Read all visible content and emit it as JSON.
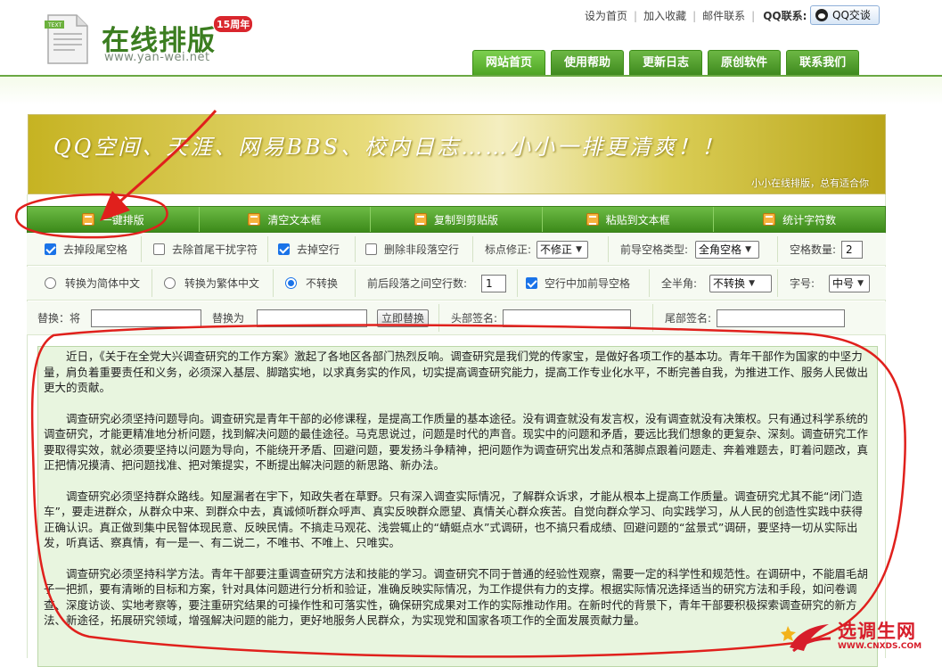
{
  "site": {
    "title": "在线排版",
    "badge": "15周年",
    "url": "www.yan-wei.net"
  },
  "toplinks": [
    "设为首页",
    "加入收藏",
    "邮件联系"
  ],
  "qq_label": "QQ联系:",
  "qq_button": "QQ交谈",
  "nav": [
    {
      "label": "网站首页",
      "active": true
    },
    {
      "label": "使用帮助",
      "active": false
    },
    {
      "label": "更新日志",
      "active": false
    },
    {
      "label": "原创软件",
      "active": false
    },
    {
      "label": "联系我们",
      "active": false
    }
  ],
  "banner": {
    "text": "QQ空间、天涯、网易BBS、校内日志……小小一排更清爽！！",
    "sub": "小小在线排版，总有适合你"
  },
  "toolbar": [
    "一键排版",
    "清空文本框",
    "复制到剪贴版",
    "粘贴到文本框",
    "统计字符数"
  ],
  "row1": {
    "trim_tail": {
      "label": "去掉段尾空格",
      "checked": true
    },
    "trim_head": {
      "label": "去除首尾干扰字符",
      "checked": false
    },
    "remove_blank": {
      "label": "去掉空行",
      "checked": true
    },
    "delete_blank_between": {
      "label": "删除非段落空行",
      "checked": false
    },
    "punct_label": "标点修正:",
    "punct_value": "不修正",
    "lead_type_label": "前导空格类型:",
    "lead_type_value": "全角空格",
    "space_count_label": "空格数量:",
    "space_count_value": "2"
  },
  "row2": {
    "to_simplified": {
      "label": "转换为简体中文",
      "checked": false
    },
    "to_traditional": {
      "label": "转换为繁体中文",
      "checked": false
    },
    "no_convert": {
      "label": "不转换",
      "checked": true
    },
    "blank_lines_label": "前后段落之间空行数:",
    "blank_lines_value": "1",
    "lead_in_blank": {
      "label": "空行中加前导空格",
      "checked": true
    },
    "width_label": "全半角:",
    "width_value": "不转换",
    "font_label": "字号:",
    "font_value": "中号"
  },
  "row3": {
    "replace_label": "替换：将",
    "replace_with_label": "替换为",
    "replace_button": "立即替换",
    "head_sign_label": "头部签名:",
    "tail_sign_label": "尾部签名:"
  },
  "editor": {
    "paragraphs": [
      "近日，《关于在全党大兴调查研究的工作方案》激起了各地区各部门热烈反响。调查研究是我们党的传家宝，是做好各项工作的基本功。青年干部作为国家的中坚力量，肩负着重要责任和义务，必须深入基层、脚踏实地，以求真务实的作风，切实提高调查研究能力，提高工作专业化水平，不断完善自我，为推进工作、服务人民做出更大的贡献。",
      "调查研究必须坚持问题导向。调查研究是青年干部的必修课程，是提高工作质量的基本途径。没有调查就没有发言权，没有调查就没有决策权。只有通过科学系统的调查研究，才能更精准地分析问题，找到解决问题的最佳途径。马克思说过，问题是时代的声音。现实中的问题和矛盾，要远比我们想象的更复杂、深刻。调查研究工作要取得实效，就必须要坚持以问题为导向，不能绕开矛盾、回避问题，要发扬斗争精神，把问题作为调查研究出发点和落脚点跟着问题走、奔着难题去，盯着问题改，真正把情况摸清、把问题找准、把对策提实，不断提出解决问题的新思路、新办法。",
      "调查研究必须坚持群众路线。知屋漏者在宇下，知政失者在草野。只有深入调查实际情况，了解群众诉求，才能从根本上提高工作质量。调查研究尤其不能“闭门造车”，要走进群众，从群众中来、到群众中去，真诚倾听群众呼声、真实反映群众愿望、真情关心群众疾苦。自觉向群众学习、向实践学习，从人民的创造性实践中获得正确认识。真正做到集中民智体现民意、反映民情。不搞走马观花、浅尝辄止的“蜻蜓点水”式调研，也不搞只看成绩、回避问题的“盆景式”调研，要坚持一切从实际出发，听真话、察真情，有一是一、有二说二，不唯书、不唯上、只唯实。",
      "调查研究必须坚持科学方法。青年干部要注重调查研究方法和技能的学习。调查研究不同于普通的经验性观察，需要一定的科学性和规范性。在调研中，不能眉毛胡子一把抓，要有清晰的目标和方案，针对具体问题进行分析和验证，准确反映实际情况，为工作提供有力的支撑。根据实际情况选择适当的研究方法和手段，如问卷调查、深度访谈、实地考察等，要注重研究结果的可操作性和可落实性，确保研究成果对工作的实际推动作用。在新时代的背景下，青年干部要积极探索调查研究的新方法、新途径，拓展研究领域，增强解决问题的能力，更好地服务人民群众，为实现党和国家各项工作的全面发展贡献力量。"
    ]
  },
  "watermark": {
    "text": "选调生网",
    "url": "WWW.CNXDS.COM"
  },
  "colors": {
    "accent_green": "#4e9a28",
    "annotation_red": "#e0201c",
    "banner_gold": "#d4c54a"
  }
}
